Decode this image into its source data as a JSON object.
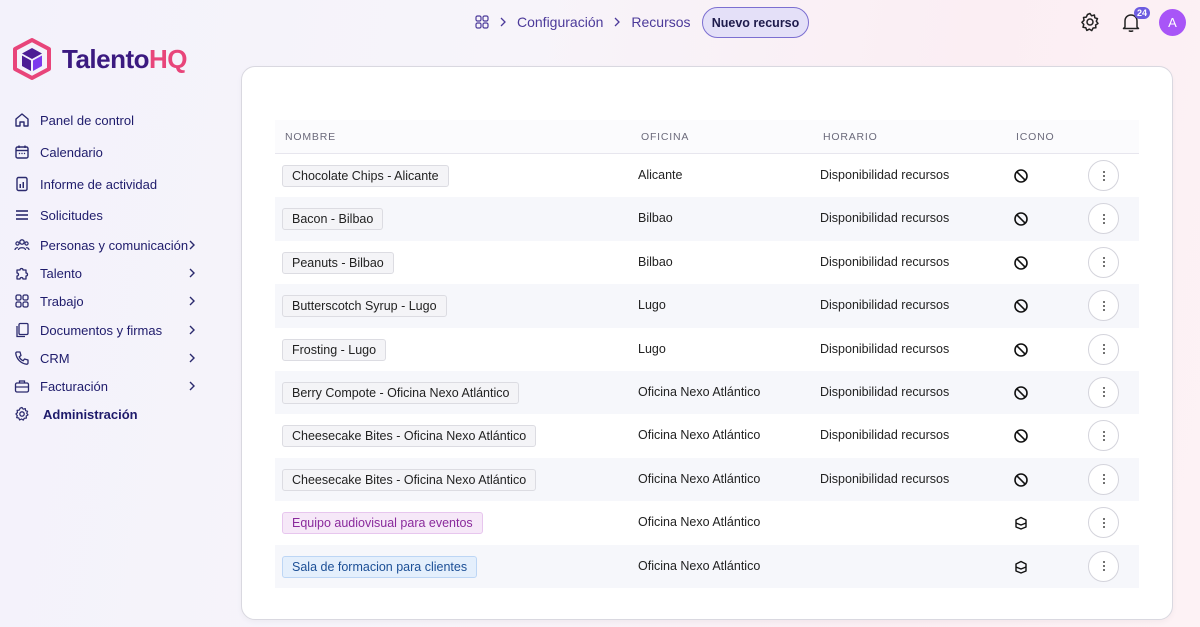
{
  "brand": {
    "name_part1": "Talento",
    "name_part2": "HQ"
  },
  "sidebar": {
    "items": [
      {
        "label": "Panel de control",
        "icon": "home-icon",
        "chevron": false
      },
      {
        "label": "Calendario",
        "icon": "calendar-icon",
        "chevron": false
      },
      {
        "label": "Informe de actividad",
        "icon": "report-icon",
        "chevron": false
      },
      {
        "label": "Solicitudes",
        "icon": "list-icon",
        "chevron": false
      },
      {
        "label": "Personas y comunicación",
        "icon": "people-icon",
        "chevron": true
      },
      {
        "label": "Talento",
        "icon": "puzzle-icon",
        "chevron": true
      },
      {
        "label": "Trabajo",
        "icon": "grid-icon",
        "chevron": true
      },
      {
        "label": "Documentos y firmas",
        "icon": "documents-icon",
        "chevron": true
      },
      {
        "label": "CRM",
        "icon": "phone-icon",
        "chevron": true
      },
      {
        "label": "Facturación",
        "icon": "briefcase-icon",
        "chevron": true
      },
      {
        "label": "Administración",
        "icon": "gear-icon",
        "chevron": false
      }
    ]
  },
  "header": {
    "breadcrumb": [
      "Configuración",
      "Recursos"
    ],
    "new_button": "Nuevo recurso",
    "notification_count": "24",
    "avatar_initial": "A"
  },
  "table": {
    "columns": [
      "NOMBRE",
      "OFICINA",
      "HORARIO",
      "ICONO"
    ],
    "rows": [
      {
        "name": "Chocolate Chips - Alicante",
        "office": "Alicante",
        "schedule": "Disponibilidad recursos",
        "icon": "ban-icon",
        "style": "default"
      },
      {
        "name": "Bacon - Bilbao",
        "office": "Bilbao",
        "schedule": "Disponibilidad recursos",
        "icon": "ban-icon",
        "style": "default"
      },
      {
        "name": "Peanuts - Bilbao",
        "office": "Bilbao",
        "schedule": "Disponibilidad recursos",
        "icon": "ban-icon",
        "style": "default"
      },
      {
        "name": "Butterscotch Syrup - Lugo",
        "office": "Lugo",
        "schedule": "Disponibilidad recursos",
        "icon": "ban-icon",
        "style": "default"
      },
      {
        "name": "Frosting - Lugo",
        "office": "Lugo",
        "schedule": "Disponibilidad recursos",
        "icon": "ban-icon",
        "style": "default"
      },
      {
        "name": "Berry Compote - Oficina Nexo Atlántico",
        "office": "Oficina Nexo Atlántico",
        "schedule": "Disponibilidad recursos",
        "icon": "ban-icon",
        "style": "default"
      },
      {
        "name": "Cheesecake Bites - Oficina Nexo Atlántico",
        "office": "Oficina Nexo Atlántico",
        "schedule": "Disponibilidad recursos",
        "icon": "ban-icon",
        "style": "default"
      },
      {
        "name": "Cheesecake Bites - Oficina Nexo Atlántico",
        "office": "Oficina Nexo Atlántico",
        "schedule": "Disponibilidad recursos",
        "icon": "ban-icon",
        "style": "default"
      },
      {
        "name": "Equipo audiovisual para eventos",
        "office": "Oficina Nexo Atlántico",
        "schedule": "",
        "icon": "box-icon",
        "style": "purple"
      },
      {
        "name": "Sala de formacion para clientes",
        "office": "Oficina Nexo Atlántico",
        "schedule": "",
        "icon": "box-icon",
        "style": "blue"
      }
    ]
  }
}
